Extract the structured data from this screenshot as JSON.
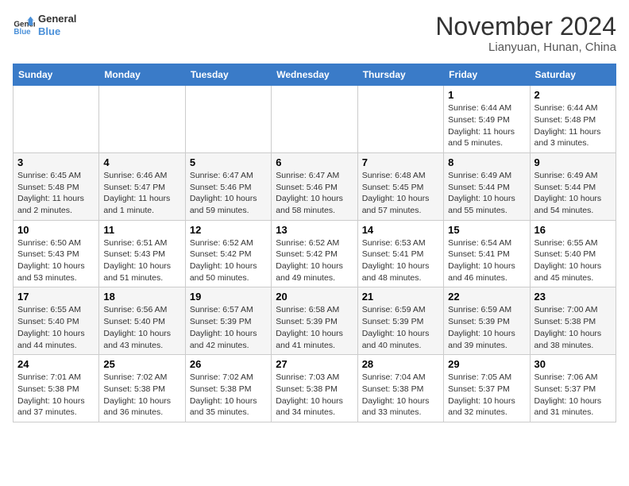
{
  "logo": {
    "line1": "General",
    "line2": "Blue"
  },
  "title": "November 2024",
  "subtitle": "Lianyuan, Hunan, China",
  "weekdays": [
    "Sunday",
    "Monday",
    "Tuesday",
    "Wednesday",
    "Thursday",
    "Friday",
    "Saturday"
  ],
  "weeks": [
    [
      {
        "day": "",
        "info": ""
      },
      {
        "day": "",
        "info": ""
      },
      {
        "day": "",
        "info": ""
      },
      {
        "day": "",
        "info": ""
      },
      {
        "day": "",
        "info": ""
      },
      {
        "day": "1",
        "info": "Sunrise: 6:44 AM\nSunset: 5:49 PM\nDaylight: 11 hours and 5 minutes."
      },
      {
        "day": "2",
        "info": "Sunrise: 6:44 AM\nSunset: 5:48 PM\nDaylight: 11 hours and 3 minutes."
      }
    ],
    [
      {
        "day": "3",
        "info": "Sunrise: 6:45 AM\nSunset: 5:48 PM\nDaylight: 11 hours and 2 minutes."
      },
      {
        "day": "4",
        "info": "Sunrise: 6:46 AM\nSunset: 5:47 PM\nDaylight: 11 hours and 1 minute."
      },
      {
        "day": "5",
        "info": "Sunrise: 6:47 AM\nSunset: 5:46 PM\nDaylight: 10 hours and 59 minutes."
      },
      {
        "day": "6",
        "info": "Sunrise: 6:47 AM\nSunset: 5:46 PM\nDaylight: 10 hours and 58 minutes."
      },
      {
        "day": "7",
        "info": "Sunrise: 6:48 AM\nSunset: 5:45 PM\nDaylight: 10 hours and 57 minutes."
      },
      {
        "day": "8",
        "info": "Sunrise: 6:49 AM\nSunset: 5:44 PM\nDaylight: 10 hours and 55 minutes."
      },
      {
        "day": "9",
        "info": "Sunrise: 6:49 AM\nSunset: 5:44 PM\nDaylight: 10 hours and 54 minutes."
      }
    ],
    [
      {
        "day": "10",
        "info": "Sunrise: 6:50 AM\nSunset: 5:43 PM\nDaylight: 10 hours and 53 minutes."
      },
      {
        "day": "11",
        "info": "Sunrise: 6:51 AM\nSunset: 5:43 PM\nDaylight: 10 hours and 51 minutes."
      },
      {
        "day": "12",
        "info": "Sunrise: 6:52 AM\nSunset: 5:42 PM\nDaylight: 10 hours and 50 minutes."
      },
      {
        "day": "13",
        "info": "Sunrise: 6:52 AM\nSunset: 5:42 PM\nDaylight: 10 hours and 49 minutes."
      },
      {
        "day": "14",
        "info": "Sunrise: 6:53 AM\nSunset: 5:41 PM\nDaylight: 10 hours and 48 minutes."
      },
      {
        "day": "15",
        "info": "Sunrise: 6:54 AM\nSunset: 5:41 PM\nDaylight: 10 hours and 46 minutes."
      },
      {
        "day": "16",
        "info": "Sunrise: 6:55 AM\nSunset: 5:40 PM\nDaylight: 10 hours and 45 minutes."
      }
    ],
    [
      {
        "day": "17",
        "info": "Sunrise: 6:55 AM\nSunset: 5:40 PM\nDaylight: 10 hours and 44 minutes."
      },
      {
        "day": "18",
        "info": "Sunrise: 6:56 AM\nSunset: 5:40 PM\nDaylight: 10 hours and 43 minutes."
      },
      {
        "day": "19",
        "info": "Sunrise: 6:57 AM\nSunset: 5:39 PM\nDaylight: 10 hours and 42 minutes."
      },
      {
        "day": "20",
        "info": "Sunrise: 6:58 AM\nSunset: 5:39 PM\nDaylight: 10 hours and 41 minutes."
      },
      {
        "day": "21",
        "info": "Sunrise: 6:59 AM\nSunset: 5:39 PM\nDaylight: 10 hours and 40 minutes."
      },
      {
        "day": "22",
        "info": "Sunrise: 6:59 AM\nSunset: 5:39 PM\nDaylight: 10 hours and 39 minutes."
      },
      {
        "day": "23",
        "info": "Sunrise: 7:00 AM\nSunset: 5:38 PM\nDaylight: 10 hours and 38 minutes."
      }
    ],
    [
      {
        "day": "24",
        "info": "Sunrise: 7:01 AM\nSunset: 5:38 PM\nDaylight: 10 hours and 37 minutes."
      },
      {
        "day": "25",
        "info": "Sunrise: 7:02 AM\nSunset: 5:38 PM\nDaylight: 10 hours and 36 minutes."
      },
      {
        "day": "26",
        "info": "Sunrise: 7:02 AM\nSunset: 5:38 PM\nDaylight: 10 hours and 35 minutes."
      },
      {
        "day": "27",
        "info": "Sunrise: 7:03 AM\nSunset: 5:38 PM\nDaylight: 10 hours and 34 minutes."
      },
      {
        "day": "28",
        "info": "Sunrise: 7:04 AM\nSunset: 5:38 PM\nDaylight: 10 hours and 33 minutes."
      },
      {
        "day": "29",
        "info": "Sunrise: 7:05 AM\nSunset: 5:37 PM\nDaylight: 10 hours and 32 minutes."
      },
      {
        "day": "30",
        "info": "Sunrise: 7:06 AM\nSunset: 5:37 PM\nDaylight: 10 hours and 31 minutes."
      }
    ]
  ]
}
